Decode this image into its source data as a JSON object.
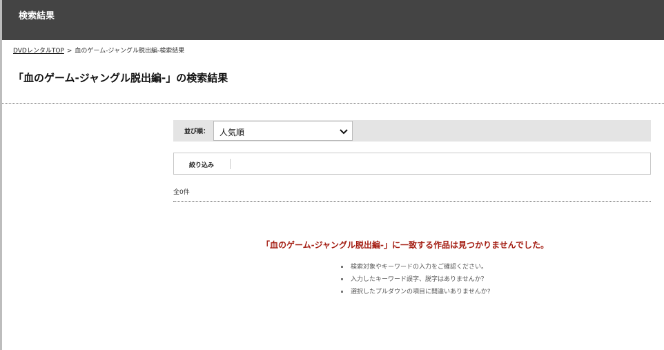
{
  "header": {
    "title": "検索結果"
  },
  "breadcrumb": {
    "home": "DVDレンタルTOP",
    "separator": ">",
    "current": "血のゲーム-ジャングル脱出編-検索結果"
  },
  "page_title": "「血のゲーム-ジャングル脱出編-」の検索結果",
  "sort": {
    "label": "並び順：",
    "selected": "人気順"
  },
  "filter": {
    "label": "絞り込み"
  },
  "count": "全0件",
  "no_results": {
    "message": "「血のゲーム-ジャングル脱出編-」に一致する作品は見つかりませんでした。",
    "tips": [
      "検索対象やキーワードの入力をご確認ください。",
      "入力したキーワード誤字、脱字はありませんか？",
      "選択したプルダウンの項目に間違いありませんか?"
    ]
  },
  "colors": {
    "header_bg": "#444444",
    "sort_bar_bg": "#e4e4e4",
    "error_text": "#a41d12"
  }
}
